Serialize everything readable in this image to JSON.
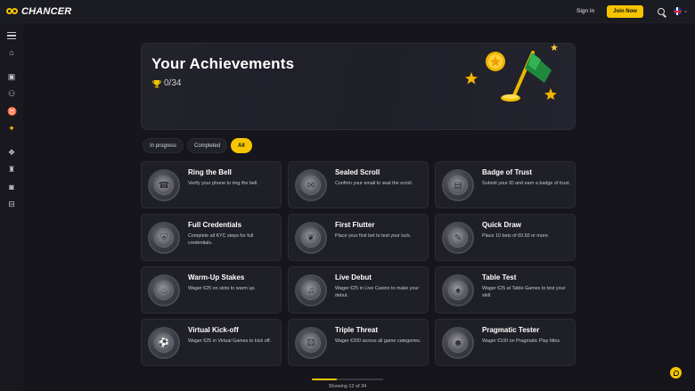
{
  "header": {
    "logo_text": "CHANCER",
    "signin_label": "Sign In",
    "join_label": "Join Now",
    "lang_chevron": "⌄",
    "accent": "#f6c500"
  },
  "sidebar": {
    "items": [
      {
        "icon": "menu-icon"
      },
      {
        "icon": "home-icon",
        "glyph": "⌂"
      },
      {
        "icon": "gift-icon",
        "glyph": "▣"
      },
      {
        "icon": "people-icon",
        "glyph": "⚇"
      },
      {
        "icon": "medal-icon",
        "glyph": "♉"
      },
      {
        "icon": "running-icon",
        "glyph": "✦"
      },
      {
        "icon": "chips-icon",
        "glyph": "❖"
      },
      {
        "icon": "chess-icon",
        "glyph": "♜"
      },
      {
        "icon": "gamepad-icon",
        "glyph": "◙"
      },
      {
        "icon": "ticket-icon",
        "glyph": "⊟"
      }
    ]
  },
  "hero": {
    "title": "Your Achievements",
    "count": "0/34"
  },
  "filters": [
    "In progress",
    "Completed",
    "All"
  ],
  "active_filter": "All",
  "achievements": [
    {
      "title": "Ring the Bell",
      "desc": "Verify your phone to ring the bell.",
      "icon": "bell-icon",
      "glyph": "☎"
    },
    {
      "title": "Sealed Scroll",
      "desc": "Confirm your email to seal the scroll.",
      "icon": "scroll-icon",
      "glyph": "✉"
    },
    {
      "title": "Badge of Trust",
      "desc": "Submit your ID and earn a badge of trust.",
      "icon": "id-card-icon",
      "glyph": "▤"
    },
    {
      "title": "Full Credentials",
      "desc": "Complete all KYC steps for full credentials.",
      "icon": "shield-icon",
      "glyph": "⛨"
    },
    {
      "title": "First Flutter",
      "desc": "Place your first bet to test your luck.",
      "icon": "butterfly-icon",
      "glyph": "❦"
    },
    {
      "title": "Quick Draw",
      "desc": "Place 10 bets of €0.50 or more.",
      "icon": "pistol-icon",
      "glyph": "✎"
    },
    {
      "title": "Warm-Up Stakes",
      "desc": "Wager €25 on slots to warm up.",
      "icon": "chili-icon",
      "glyph": "♨"
    },
    {
      "title": "Live Debut",
      "desc": "Wager €25 in Live Casino to make your debut.",
      "icon": "mic-icon",
      "glyph": "♫"
    },
    {
      "title": "Table Test",
      "desc": "Wager €25 at Table Games to test your skill.",
      "icon": "cards-icon",
      "glyph": "♠"
    },
    {
      "title": "Virtual Kick-off",
      "desc": "Wager €25 in Virtual Games to kick off.",
      "icon": "football-icon",
      "glyph": "⚽"
    },
    {
      "title": "Triple Threat",
      "desc": "Wager €200 across all game categories.",
      "icon": "dice-icon",
      "glyph": "⚄"
    },
    {
      "title": "Pragmatic Tester",
      "desc": "Wager €100 on Pragmatic Play titles.",
      "icon": "monkey-icon",
      "glyph": "☻"
    }
  ],
  "pagination": {
    "text": "Showing 12 of 34",
    "shown": 12,
    "total": 34
  }
}
